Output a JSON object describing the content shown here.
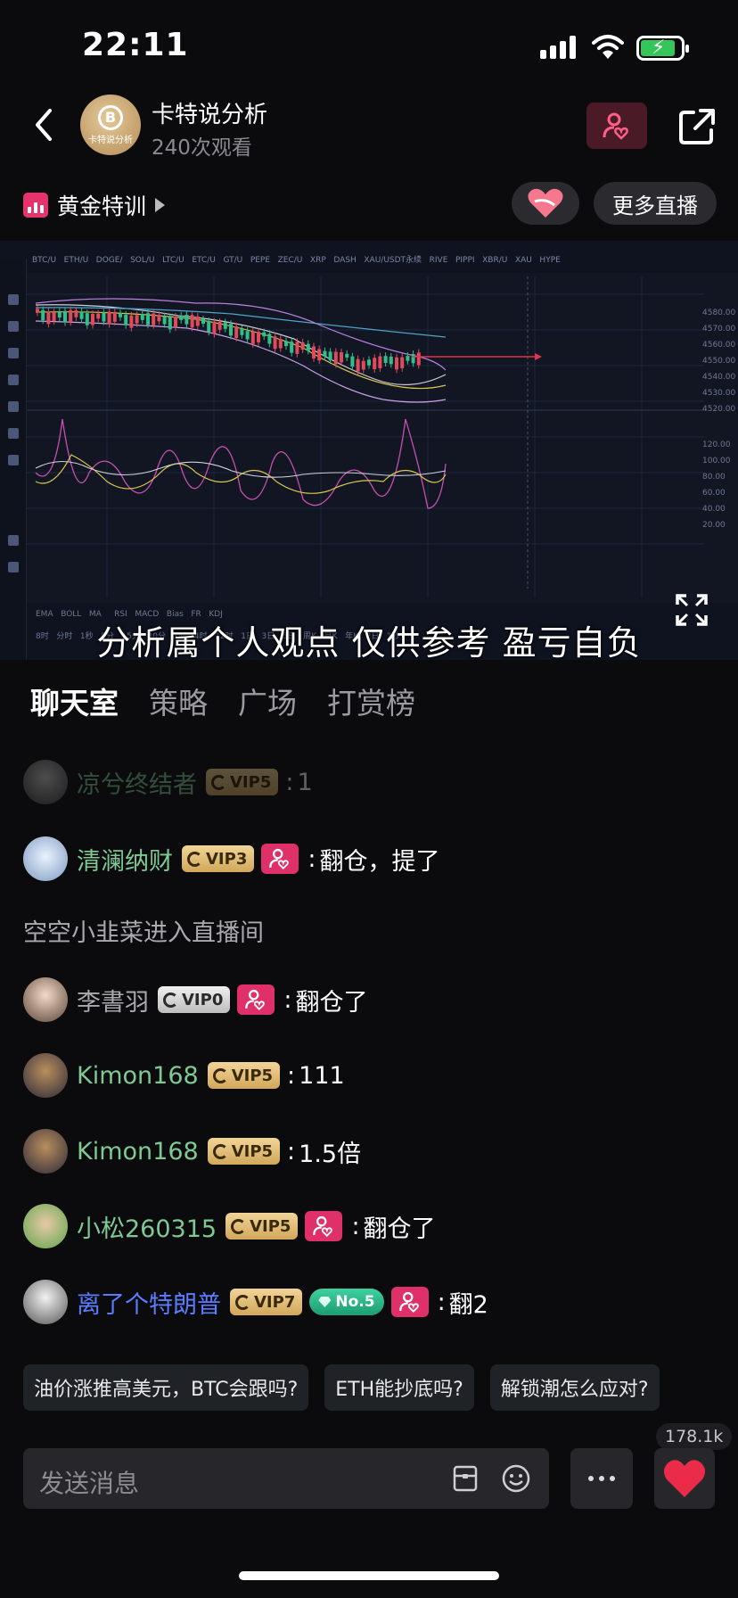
{
  "status": {
    "time": "22:11"
  },
  "header": {
    "channel_name": "卡特说分析",
    "view_count": "240次观看",
    "avatar_text": "卡特说分析"
  },
  "subheader": {
    "room_tag": "黄金特训",
    "more_live_label": "更多直播"
  },
  "video": {
    "caption": "分析属个人观点 仅供参考 盈亏自负"
  },
  "tabs": [
    "聊天室",
    "策略",
    "广场",
    "打赏榜"
  ],
  "chat": {
    "messages": [
      {
        "user": "凉兮终结者",
        "vip": "VIP5",
        "text": "1"
      },
      {
        "user": "清澜纳财",
        "vip": "VIP3",
        "text": "翻仓，提了"
      },
      {
        "system": "空空小韭菜进入直播间"
      },
      {
        "user": "李書羽",
        "vip": "VIP0",
        "text": "翻仓了"
      },
      {
        "user": "Kimon168",
        "vip": "VIP5",
        "text": "111"
      },
      {
        "user": "Kimon168",
        "vip": "VIP5",
        "text": "1.5倍"
      },
      {
        "user": "小松260315",
        "vip": "VIP5",
        "text": "翻仓了"
      },
      {
        "user": "离了个特朗普",
        "vip": "VIP7",
        "rank": "No.5",
        "text": "翻2"
      }
    ]
  },
  "chips": [
    "油价涨推高美元，BTC会跟吗?",
    "ETH能抄底吗?",
    "解锁潮怎么应对?"
  ],
  "input": {
    "placeholder": "发送消息",
    "like_count": "178.1k"
  },
  "colors": {
    "accent_pink": "#e0306a",
    "name_green": "#7ec994",
    "name_blue": "#5a7dff",
    "vip_gold": "#d1a75a"
  },
  "icons": [
    "back-icon",
    "follow-heart-icon",
    "share-icon",
    "bar-chart-icon",
    "handshake-heart-icon",
    "fullscreen-icon",
    "coupon-icon",
    "emoji-icon",
    "more-dots-icon",
    "heart-icon"
  ]
}
